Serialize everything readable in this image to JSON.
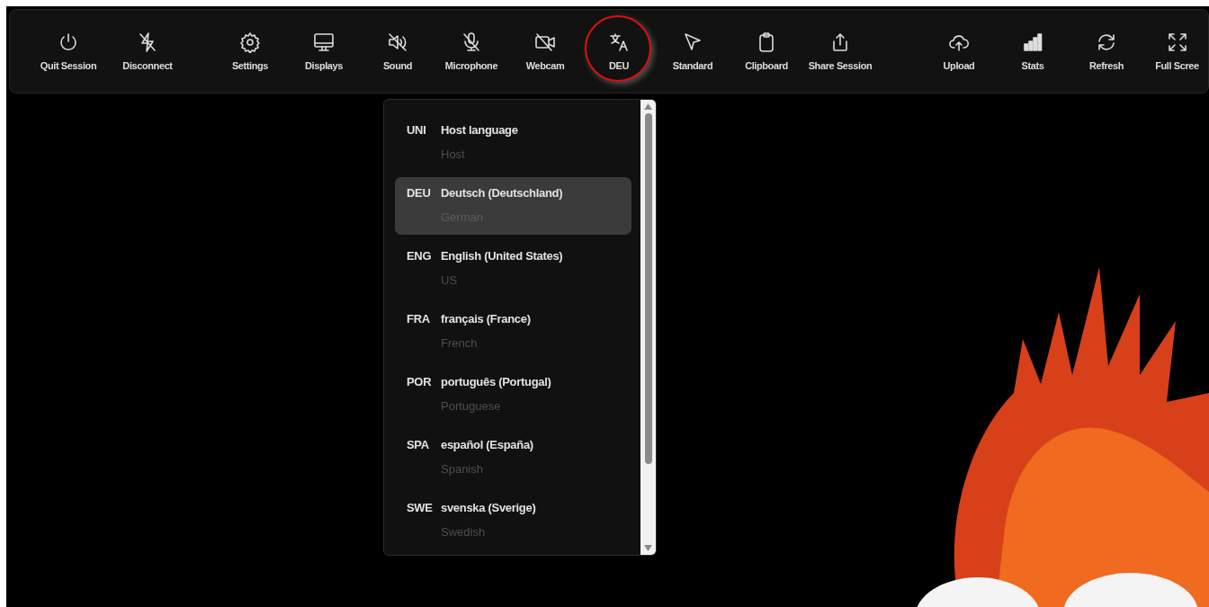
{
  "toolbar": {
    "groups": [
      [
        {
          "kind": "power",
          "label": "Quit Session",
          "annotated": false
        },
        {
          "kind": "unplug",
          "label": "Disconnect",
          "annotated": false
        }
      ],
      [
        {
          "kind": "gear",
          "label": "Settings",
          "annotated": false
        },
        {
          "kind": "monitor",
          "label": "Displays",
          "annotated": false
        },
        {
          "kind": "speaker-off",
          "label": "Sound",
          "annotated": false
        },
        {
          "kind": "mic-off",
          "label": "Microphone",
          "annotated": false
        },
        {
          "kind": "camera-off",
          "label": "Webcam",
          "annotated": false
        },
        {
          "kind": "translate",
          "label": "DEU",
          "annotated": true
        },
        {
          "kind": "pointer",
          "label": "Standard",
          "annotated": false
        },
        {
          "kind": "clipboard",
          "label": "Clipboard",
          "annotated": false
        },
        {
          "kind": "share",
          "label": "Share Session",
          "annotated": false
        }
      ],
      [
        {
          "kind": "cloud-upload",
          "label": "Upload",
          "annotated": false
        },
        {
          "kind": "bars",
          "label": "Stats",
          "annotated": false
        },
        {
          "kind": "refresh",
          "label": "Refresh",
          "annotated": false
        },
        {
          "kind": "expand",
          "label": "Full Scree",
          "annotated": false
        }
      ]
    ]
  },
  "language_menu": {
    "items": [
      {
        "code": "UNI",
        "name": "Host language",
        "subtitle": "Host",
        "selected": false
      },
      {
        "code": "DEU",
        "name": "Deutsch (Deutschland)",
        "subtitle": "German",
        "selected": true
      },
      {
        "code": "ENG",
        "name": "English (United States)",
        "subtitle": "US",
        "selected": false
      },
      {
        "code": "FRA",
        "name": "français (France)",
        "subtitle": "French",
        "selected": false
      },
      {
        "code": "POR",
        "name": "português (Portugal)",
        "subtitle": "Portuguese",
        "selected": false
      },
      {
        "code": "SPA",
        "name": "español (España)",
        "subtitle": "Spanish",
        "selected": false
      },
      {
        "code": "SWE",
        "name": "svenska (Sverige)",
        "subtitle": "Swedish",
        "selected": false
      }
    ]
  }
}
